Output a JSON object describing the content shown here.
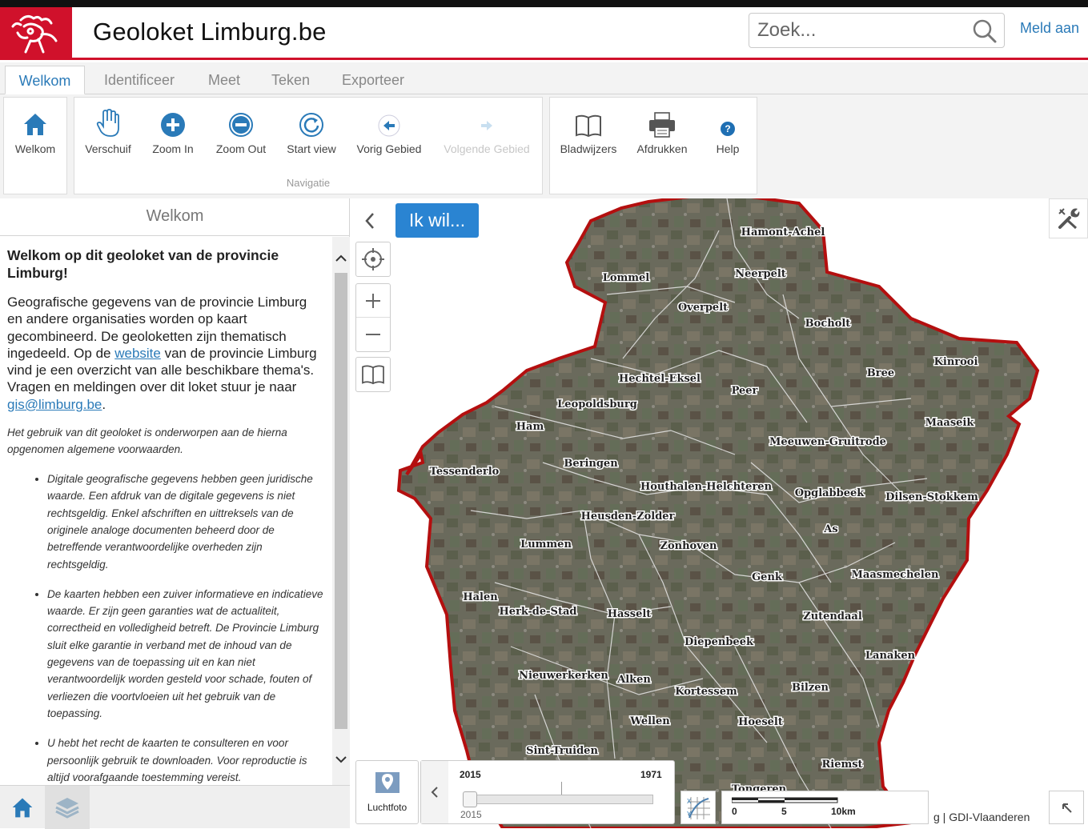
{
  "header": {
    "title": "Geoloket Limburg.be",
    "search_placeholder": "Zoek...",
    "login": "Meld aan"
  },
  "tabs": [
    "Welkom",
    "Identificeer",
    "Meet",
    "Teken",
    "Exporteer"
  ],
  "ribbon": {
    "welkom": "Welkom",
    "navigation": {
      "pan": "Verschuif",
      "zoom_in": "Zoom In",
      "zoom_out": "Zoom Out",
      "start_view": "Start view",
      "previous": "Vorig Gebied",
      "next": "Volgende Gebied",
      "group_label": "Navigatie"
    },
    "bookmarks": "Bladwijzers",
    "print": "Afdrukken",
    "help": "Help"
  },
  "panel": {
    "title": "Welkom",
    "heading": "Welkom op dit geoloket van de provincie Limburg!",
    "intro_1": "Geografische gegevens van de provincie Limburg en andere organisaties worden op kaart gecombineerd. De geoloketten zijn thematisch ingedeeld. Op de ",
    "intro_link": "website",
    "intro_2": " van de provincie Limburg vind je een overzicht van alle beschikbare thema's. Vragen en meldingen over dit loket stuur je naar ",
    "email": "gis@limburg.be",
    "intro_end": ".",
    "terms": "Het gebruik van dit geoloket is onderworpen aan de hierna opgenomen algemene voorwaarden.",
    "bullets": [
      "Digitale geografische gegevens hebben geen juridische waarde. Een afdruk van de digitale gegevens is niet rechtsgeldig. Enkel afschriften en uittreksels van de originele analoge documenten beheerd door de betreffende verantwoordelijke overheden zijn rechtsgeldig.",
      "De kaarten hebben een zuiver informatieve en indicatieve waarde. Er zijn geen garanties wat de actualiteit, correctheid en volledigheid betreft. De Provincie Limburg sluit elke garantie in verband met de inhoud van de gegevens van de toepassing uit en kan niet verantwoordelijk worden gesteld voor schade, fouten of verliezen die voortvloeien uit het gebruik van de toepassing.",
      "U hebt het recht de kaarten te consulteren en voor persoonlijk gebruik te downloaden. Voor reproductie is altijd voorafgaande toestemming vereist."
    ]
  },
  "map": {
    "ikwil": "Ik wil...",
    "basemap": "Luchtfoto",
    "timeslider": {
      "start": "2015",
      "end": "1971",
      "current": "2015"
    },
    "scale": [
      "0",
      "5",
      "10km"
    ],
    "attribution": "g | GDI-Vlaanderen",
    "municipalities": [
      "Hamont-Achel",
      "Lommel",
      "Neerpelt",
      "Overpelt",
      "Bocholt",
      "Kinrooi",
      "Bree",
      "Hechtel-Eksel",
      "Peer",
      "Leopoldsburg",
      "Maaseik",
      "Ham",
      "Meeuwen-Gruitrode",
      "Tessenderlo",
      "Beringen",
      "Houthalen-Helchteren",
      "Opglabbeek",
      "Dilsen-Stokkem",
      "Heusden-Zolder",
      "As",
      "Lummen",
      "Zonhoven",
      "Genk",
      "Maasmechelen",
      "Halen",
      "Herk-de-Stad",
      "Hasselt",
      "Zutendaal",
      "Diepenbeek",
      "Lanaken",
      "Nieuwerkerken",
      "Alken",
      "Kortessem",
      "Bilzen",
      "Wellen",
      "Hoeselt",
      "Sint-Truiden",
      "Riemst",
      "Tongeren"
    ]
  },
  "colors": {
    "brand_red": "#d0112b",
    "link_blue": "#2a7ab8",
    "button_blue": "#2a84d2",
    "border_red": "#b40f0f"
  }
}
